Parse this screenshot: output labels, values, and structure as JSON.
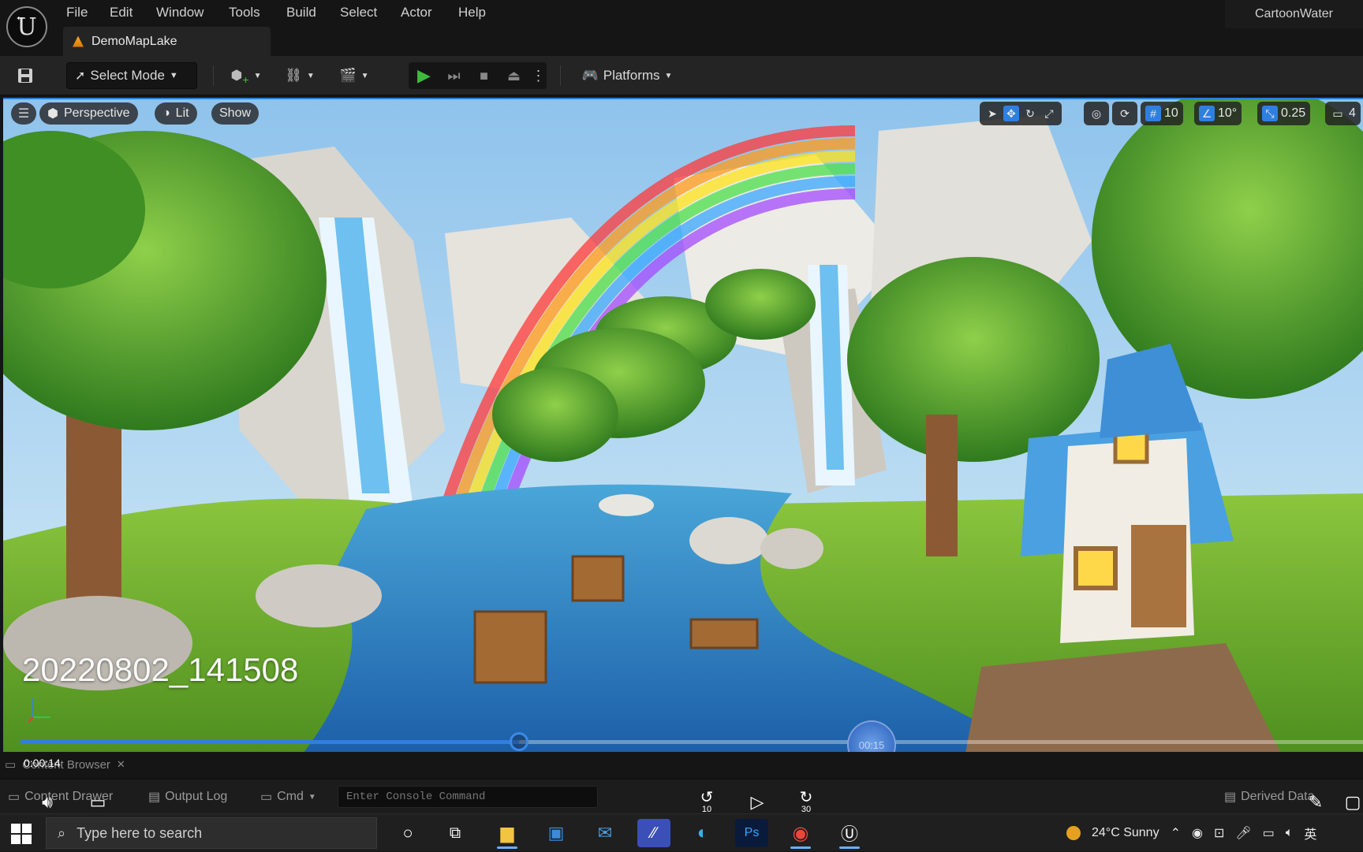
{
  "menu": {
    "items": [
      "File",
      "Edit",
      "Window",
      "Tools",
      "Build",
      "Select",
      "Actor",
      "Help"
    ],
    "project_name": "CartoonWater",
    "document_tab": "DemoMapLake"
  },
  "toolbar": {
    "select_mode": "Select Mode",
    "platforms": "Platforms"
  },
  "viewport": {
    "view_mode": "Perspective",
    "lighting": "Lit",
    "show": "Show",
    "grid_snap": "10",
    "rotation_snap": "10°",
    "scale_snap": "0.25",
    "camera_speed": "4",
    "video_label": "20220802_141508"
  },
  "video": {
    "current_time": "0:00:14",
    "preview_time": "00:15",
    "progress": 0.3715,
    "rewind_label": "10",
    "forward_label": "30"
  },
  "bottom": {
    "content_browser_tab": "Content Browser",
    "content_drawer": "Content Drawer",
    "output_log": "Output Log",
    "cmd": "Cmd",
    "console_placeholder": "Enter Console Command",
    "derived_data": "Derived Data"
  },
  "taskbar": {
    "search_placeholder": "Type here to search",
    "weather": "24°C  Sunny",
    "lang": "英"
  },
  "colors": {
    "accent": "#2f7fe0",
    "play_green": "#3dbb3d",
    "bar_bg": "#151515"
  }
}
